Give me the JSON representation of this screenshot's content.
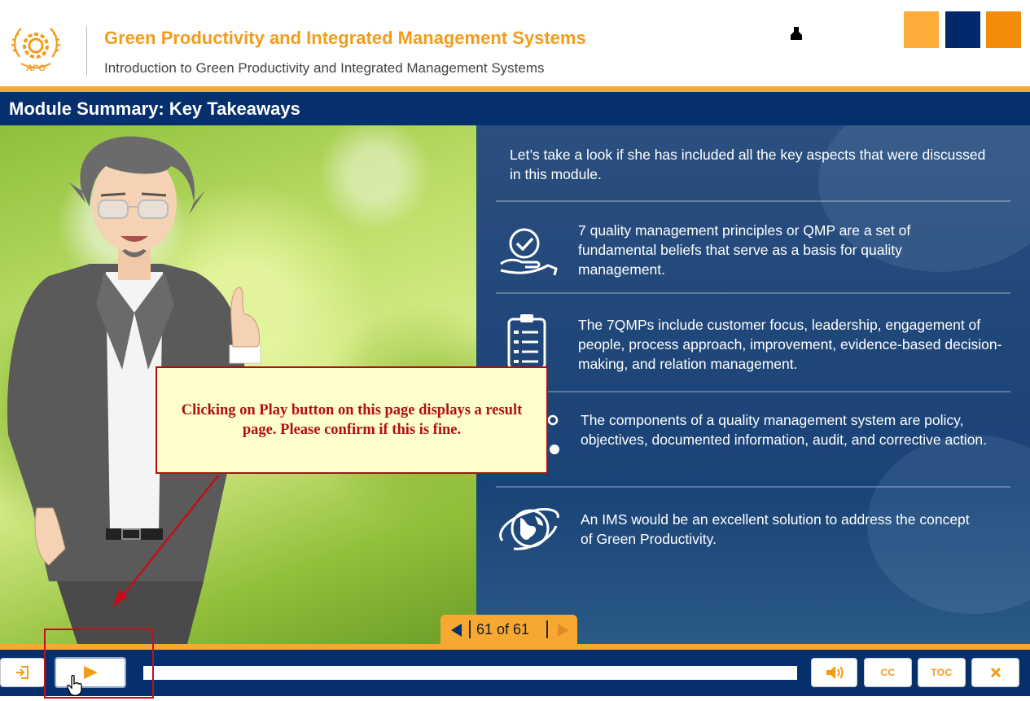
{
  "header": {
    "course_title": "Green Productivity and Integrated Management Systems",
    "course_subtitle": "Introduction to Green Productivity and Integrated Management Systems",
    "logo_text": "APO",
    "swatches": [
      "#fbad3a",
      "#00296b",
      "#f28c0a"
    ]
  },
  "slide": {
    "title": "Module Summary: Key Takeaways",
    "intro": "Let’s take a look if she has included all the key aspects that were discussed in this module.",
    "items": [
      {
        "icon": "check-hand-icon",
        "text": "7 quality management principles or QMP are a set of fundamental beliefs that serve as a basis for quality management."
      },
      {
        "icon": "clipboard-list-icon",
        "text": "The 7QMPs include customer focus, leadership, engagement of people, process approach, improvement, evidence-based decision-making, and relation management."
      },
      {
        "icon": "components-icon",
        "text": "The components of a quality management system are policy, objectives, documented information, audit, and corrective action."
      },
      {
        "icon": "globe-orbit-icon",
        "text": "An IMS would be an excellent solution to address the concept of Green Productivity."
      }
    ]
  },
  "review_note": "Clicking on Play button on this page displays a result page. Please confirm if this is fine.",
  "navigation": {
    "page_label": "61 of 61"
  },
  "controls": {
    "cc_label": "CC",
    "toc_label": "TOC",
    "progress_fraction": 0.0,
    "icons": [
      "exit-icon",
      "play-icon",
      "audio-icon",
      "close-icon"
    ]
  },
  "colors": {
    "brand_orange": "#f7a832",
    "brand_navy": "#05306d",
    "title_orange": "#f39c1a",
    "note_red": "#b01010"
  }
}
